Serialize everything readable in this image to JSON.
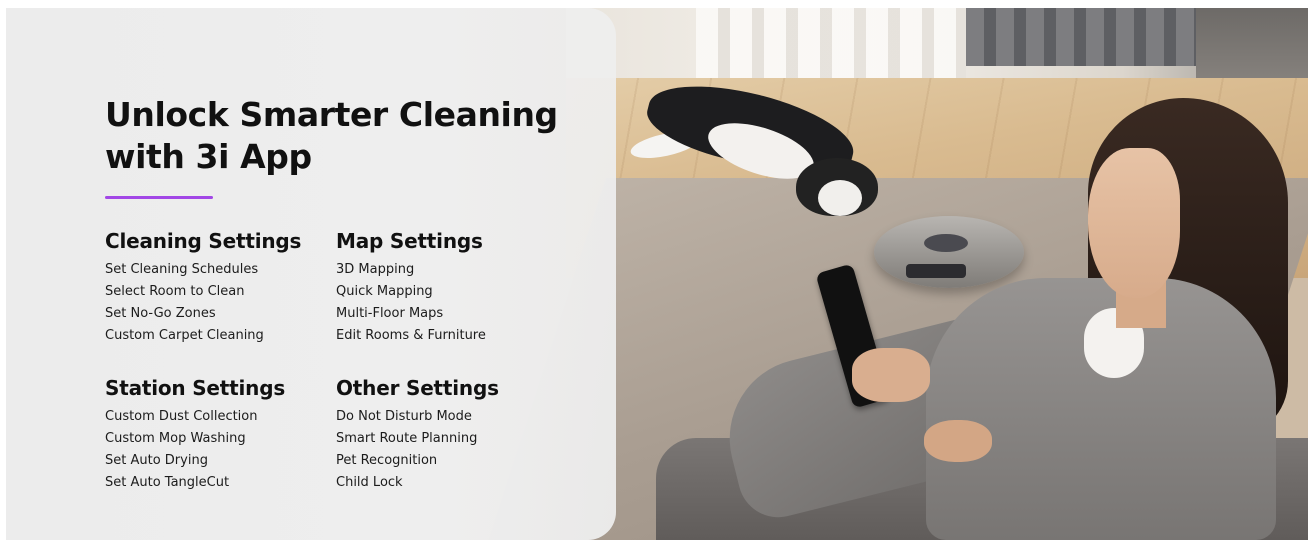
{
  "title": "Unlock Smarter Cleaning with 3i App",
  "accent_color": "#a247e6",
  "sections": [
    {
      "heading": "Cleaning Settings",
      "items": [
        "Set Cleaning Schedules",
        "Select Room to Clean",
        "Set No-Go Zones",
        "Custom Carpet Cleaning"
      ]
    },
    {
      "heading": "Map Settings",
      "items": [
        "3D Mapping",
        "Quick Mapping",
        "Multi-Floor Maps",
        "Edit Rooms & Furniture"
      ]
    },
    {
      "heading": "Station Settings",
      "items": [
        "Custom Dust Collection",
        "Custom Mop Washing",
        "Set Auto Drying",
        "Set Auto TangleCut"
      ]
    },
    {
      "heading": "Other Settings",
      "items": [
        "Do Not Disturb Mode",
        "Smart Route Planning",
        "Pet Recognition",
        "Child Lock"
      ]
    }
  ]
}
